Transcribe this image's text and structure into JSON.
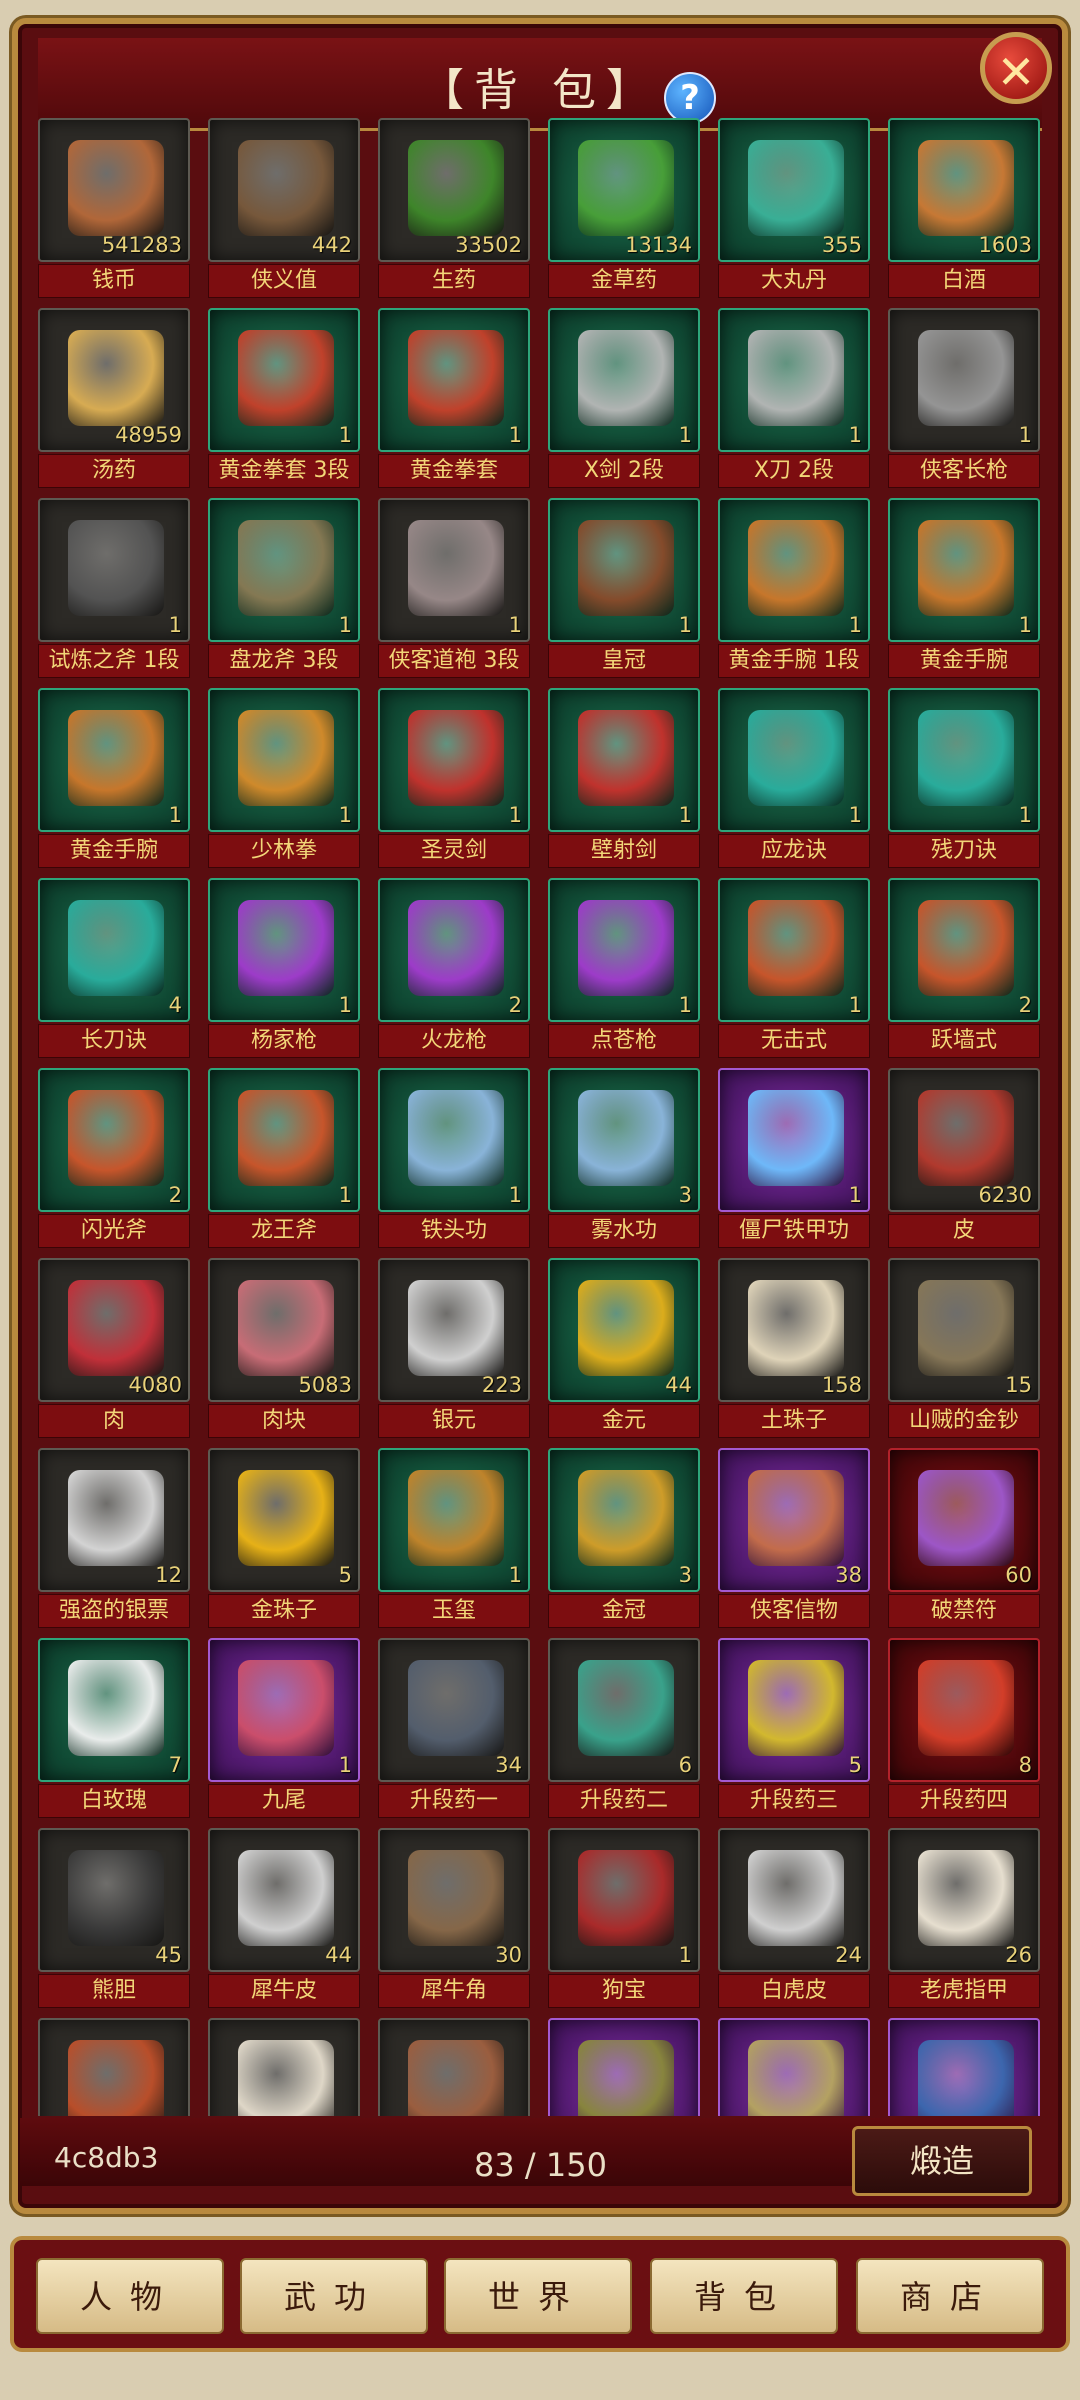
{
  "header": {
    "title": "【背 包】",
    "help_icon": "question-icon",
    "close_icon": "close-icon"
  },
  "inventory": {
    "items": [
      {
        "name": "钱币",
        "count": "541283",
        "rarity": "dark",
        "icon": "copper-coin-icon",
        "color": "#b86a3a"
      },
      {
        "name": "侠义值",
        "count": "442",
        "rarity": "dark",
        "icon": "plaque-icon",
        "color": "#7a5a3c"
      },
      {
        "name": "生药",
        "count": "33502",
        "rarity": "dark",
        "icon": "herb-icon",
        "color": "#3f8a2a"
      },
      {
        "name": "金草药",
        "count": "13134",
        "rarity": "green",
        "icon": "golden-herb-icon",
        "color": "#4aa238"
      },
      {
        "name": "大丸丹",
        "count": "355",
        "rarity": "green",
        "icon": "pills-icon",
        "color": "#3bb39a"
      },
      {
        "name": "白酒",
        "count": "1603",
        "rarity": "green",
        "icon": "wine-jar-icon",
        "color": "#d07a34"
      },
      {
        "name": "汤药",
        "count": "48959",
        "rarity": "dark",
        "icon": "medicine-bottle-icon",
        "color": "#e0b255"
      },
      {
        "name": "黄金拳套 3段",
        "count": "1",
        "rarity": "green",
        "icon": "golden-gauntlet-icon",
        "color": "#c9402a"
      },
      {
        "name": "黄金拳套",
        "count": "1",
        "rarity": "green",
        "icon": "golden-gauntlet-icon",
        "color": "#c9402a"
      },
      {
        "name": "X剑 2段",
        "count": "1",
        "rarity": "green",
        "icon": "hook-blade-icon",
        "color": "#b9b9b9"
      },
      {
        "name": "X刀 2段",
        "count": "1",
        "rarity": "green",
        "icon": "hook-blade-icon",
        "color": "#b9b9b9"
      },
      {
        "name": "侠客长枪",
        "count": "1",
        "rarity": "dark",
        "icon": "spear-icon",
        "color": "#9a9a9a"
      },
      {
        "name": "试炼之斧 1段",
        "count": "1",
        "rarity": "dark",
        "icon": "axe-icon",
        "color": "#555555"
      },
      {
        "name": "盘龙斧 3段",
        "count": "1",
        "rarity": "green",
        "icon": "dragon-axe-icon",
        "color": "#8a7a54"
      },
      {
        "name": "侠客道袍 3段",
        "count": "1",
        "rarity": "dark",
        "icon": "robe-icon",
        "color": "#9c8c8c"
      },
      {
        "name": "皇冠",
        "count": "1",
        "rarity": "green",
        "icon": "bracer-icon",
        "color": "#8a4a2a"
      },
      {
        "name": "黄金手腕 1段",
        "count": "1",
        "rarity": "green",
        "icon": "golden-bracelet-icon",
        "color": "#d0782a"
      },
      {
        "name": "黄金手腕",
        "count": "1",
        "rarity": "green",
        "icon": "golden-bracelet-icon",
        "color": "#d0782a"
      },
      {
        "name": "黄金手腕",
        "count": "1",
        "rarity": "green",
        "icon": "golden-bracelet-icon",
        "color": "#d0782a"
      },
      {
        "name": "少林拳",
        "count": "1",
        "rarity": "green",
        "icon": "orange-manual-icon",
        "color": "#d98c2a"
      },
      {
        "name": "圣灵剑",
        "count": "1",
        "rarity": "green",
        "icon": "red-manual-icon",
        "color": "#c9302c"
      },
      {
        "name": "壁射剑",
        "count": "1",
        "rarity": "green",
        "icon": "red-manual-icon",
        "color": "#c9302c"
      },
      {
        "name": "应龙诀",
        "count": "1",
        "rarity": "green",
        "icon": "teal-manual-icon",
        "color": "#2ab0a0"
      },
      {
        "name": "残刀诀",
        "count": "1",
        "rarity": "green",
        "icon": "teal-manual-icon",
        "color": "#2ab0a0"
      },
      {
        "name": "长刀诀",
        "count": "4",
        "rarity": "green",
        "icon": "teal-manual-icon",
        "color": "#2ab0a0"
      },
      {
        "name": "杨家枪",
        "count": "1",
        "rarity": "green",
        "icon": "purple-manual-icon",
        "color": "#a43ad0"
      },
      {
        "name": "火龙枪",
        "count": "2",
        "rarity": "green",
        "icon": "purple-manual-icon",
        "color": "#a43ad0"
      },
      {
        "name": "点苍枪",
        "count": "1",
        "rarity": "green",
        "icon": "purple-manual-icon",
        "color": "#a43ad0"
      },
      {
        "name": "无击式",
        "count": "1",
        "rarity": "green",
        "icon": "orange-red-manual-icon",
        "color": "#d0552a"
      },
      {
        "name": "跃墙式",
        "count": "2",
        "rarity": "green",
        "icon": "orange-red-manual-icon",
        "color": "#d0552a"
      },
      {
        "name": "闪光斧",
        "count": "2",
        "rarity": "green",
        "icon": "orange-red-manual-icon",
        "color": "#d0552a"
      },
      {
        "name": "龙王斧",
        "count": "1",
        "rarity": "green",
        "icon": "orange-red-manual-icon",
        "color": "#d0552a"
      },
      {
        "name": "铁头功",
        "count": "1",
        "rarity": "green",
        "icon": "blue-manual-icon",
        "color": "#8fb8e0"
      },
      {
        "name": "雾水功",
        "count": "3",
        "rarity": "green",
        "icon": "blue-manual-icon",
        "color": "#8fb8e0"
      },
      {
        "name": "僵尸铁甲功",
        "count": "1",
        "rarity": "purple",
        "icon": "glowing-manual-icon",
        "color": "#6fc0ff"
      },
      {
        "name": "皮",
        "count": "6230",
        "rarity": "dark",
        "icon": "hide-icon",
        "color": "#b83a2e"
      },
      {
        "name": "肉",
        "count": "4080",
        "rarity": "dark",
        "icon": "meat-icon",
        "color": "#c8303a"
      },
      {
        "name": "肉块",
        "count": "5083",
        "rarity": "dark",
        "icon": "meat-chunk-icon",
        "color": "#d0707a"
      },
      {
        "name": "银元",
        "count": "223",
        "rarity": "dark",
        "icon": "silver-coin-icon",
        "color": "#d8d8d8"
      },
      {
        "name": "金元",
        "count": "44",
        "rarity": "green",
        "icon": "gold-coin-icon",
        "color": "#e6b11a"
      },
      {
        "name": "土珠子",
        "count": "158",
        "rarity": "dark",
        "icon": "pearl-stand-icon",
        "color": "#e8dcc0"
      },
      {
        "name": "山贼的金钞",
        "count": "15",
        "rarity": "dark",
        "icon": "banknotes-icon",
        "color": "#8a7a5a"
      },
      {
        "name": "强盗的银票",
        "count": "12",
        "rarity": "dark",
        "icon": "silver-notes-icon",
        "color": "#dcdcdc"
      },
      {
        "name": "金珠子",
        "count": "5",
        "rarity": "dark",
        "icon": "gold-orb-icon",
        "color": "#f0b816"
      },
      {
        "name": "玉玺",
        "count": "1",
        "rarity": "green",
        "icon": "seal-icon",
        "color": "#c8862a"
      },
      {
        "name": "金冠",
        "count": "3",
        "rarity": "green",
        "icon": "gold-crown-icon",
        "color": "#d8a028"
      },
      {
        "name": "侠客信物",
        "count": "38",
        "rarity": "purple",
        "icon": "scroll-icon",
        "color": "#c87048"
      },
      {
        "name": "破禁符",
        "count": "60",
        "rarity": "red",
        "icon": "talisman-icon",
        "color": "#a05ad0"
      },
      {
        "name": "白玫瑰",
        "count": "7",
        "rarity": "green",
        "icon": "white-rose-icon",
        "color": "#f4f4f4"
      },
      {
        "name": "九尾",
        "count": "1",
        "rarity": "purple",
        "icon": "fox-tail-icon",
        "color": "#d0506a"
      },
      {
        "name": "升段药一",
        "count": "34",
        "rarity": "dark",
        "icon": "jar-icon",
        "color": "#556070"
      },
      {
        "name": "升段药二",
        "count": "6",
        "rarity": "dark",
        "icon": "jar-icon",
        "color": "#3aa890"
      },
      {
        "name": "升段药三",
        "count": "5",
        "rarity": "purple",
        "icon": "jar-icon",
        "color": "#d8c02a"
      },
      {
        "name": "升段药四",
        "count": "8",
        "rarity": "red",
        "icon": "jar-icon",
        "color": "#d8402a"
      },
      {
        "name": "熊胆",
        "count": "45",
        "rarity": "dark",
        "icon": "bear-gall-icon",
        "color": "#3a3a3a"
      },
      {
        "name": "犀牛皮",
        "count": "44",
        "rarity": "dark",
        "icon": "fur-icon",
        "color": "#d8d8d8"
      },
      {
        "name": "犀牛角",
        "count": "30",
        "rarity": "dark",
        "icon": "horn-icon",
        "color": "#8a6a4a"
      },
      {
        "name": "狗宝",
        "count": "1",
        "rarity": "dark",
        "icon": "red-bead-icon",
        "color": "#b02a2a"
      },
      {
        "name": "白虎皮",
        "count": "24",
        "rarity": "dark",
        "icon": "fur-icon",
        "color": "#d8d8d8"
      },
      {
        "name": "老虎指甲",
        "count": "26",
        "rarity": "dark",
        "icon": "claw-icon",
        "color": "#f0e8d8"
      },
      {
        "name": "",
        "count": "",
        "rarity": "dark",
        "icon": "scorpion-icon",
        "color": "#c0502a"
      },
      {
        "name": "",
        "count": "",
        "rarity": "dark",
        "icon": "bones-icon",
        "color": "#e8e0d0"
      },
      {
        "name": "",
        "count": "",
        "rarity": "dark",
        "icon": "antler-icon",
        "color": "#a06040"
      },
      {
        "name": "",
        "count": "",
        "rarity": "purple",
        "icon": "map-scroll-icon",
        "color": "#8a8a3a"
      },
      {
        "name": "",
        "count": "",
        "rarity": "purple",
        "icon": "map-scroll-icon",
        "color": "#b8a860"
      },
      {
        "name": "",
        "count": "",
        "rarity": "purple",
        "icon": "map-scroll-icon",
        "color": "#3a6ab0"
      }
    ]
  },
  "footer": {
    "code": "4c8db3",
    "capacity": "83 / 150",
    "forge_label": "煅造"
  },
  "nav": {
    "tabs": [
      "人物",
      "武功",
      "世界",
      "背包",
      "商店"
    ]
  }
}
